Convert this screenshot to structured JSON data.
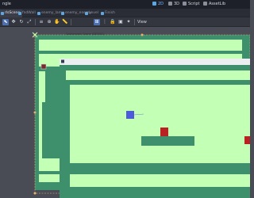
{
  "editor": {
    "topbar": {
      "left_label": "ngle",
      "workspaces": [
        "2D",
        "3D",
        "Script",
        "AssetLib"
      ]
    },
    "tabs": [
      {
        "label": "rlsScene",
        "active": true
      },
      {
        "label": "fndWall",
        "active": false
      },
      {
        "label": "enemy_lamp",
        "active": false
      },
      {
        "label": "enemy_enemy",
        "active": false
      },
      {
        "label": "Level",
        "active": false
      },
      {
        "label": "Finish",
        "active": false
      }
    ],
    "toolbar": {
      "view_label": "View"
    }
  },
  "game_window": {
    "title": "Gallowseer Game (DEBUG)"
  },
  "colors": {
    "floor": "#3e8f6c",
    "background": "#c4ffb6",
    "player": "#4b5bd9",
    "enemy": "#b82222",
    "selection": "#e8b06e"
  }
}
